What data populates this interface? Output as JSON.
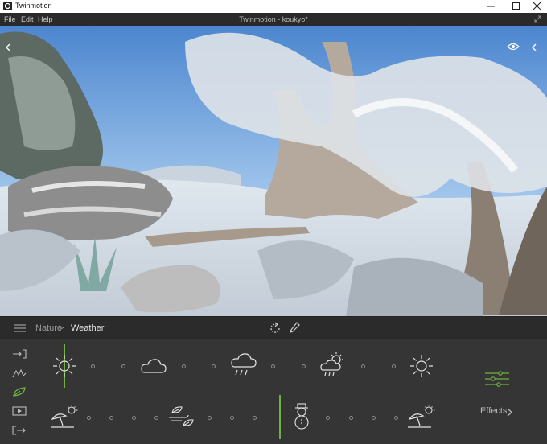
{
  "window": {
    "app_title": "Twinmotion",
    "icons": {
      "app": "twinmotion-logo-icon",
      "minimize": "minimize-icon",
      "maximize": "maximize-icon",
      "close": "close-icon"
    }
  },
  "menu": {
    "items": [
      "File",
      "Edit",
      "Help"
    ],
    "document_title": "Twinmotion - koukyo*",
    "expand_icon": "expand-icon"
  },
  "viewport": {
    "left_icon": "chevron-left-icon",
    "eye_icon": "eye-icon",
    "right_icon": "chevron-left-icon"
  },
  "breadcrumb": {
    "menu_icon": "hamburger-icon",
    "parent": "Nature",
    "separator": ">",
    "current": "Weather",
    "tools": [
      "refresh-icon",
      "pencil-icon"
    ]
  },
  "panel": {
    "side_icons": [
      "import-icon",
      "landscape-icon",
      "leaf-icon",
      "media-icon",
      "export-icon"
    ],
    "active_side_icon": "leaf-icon",
    "weather_row": [
      "sun-icon",
      "cloud-icon",
      "rain-icon",
      "partly-cloudy-rain-icon",
      "sun-icon"
    ],
    "season_row": [
      "beach-umbrella-sun-icon",
      "autumn-wind-leaf-icon",
      "snowman-icon",
      "beach-umbrella-sun-icon"
    ],
    "settings_icon": "sliders-icon",
    "effects_label": "Effects",
    "effects_icon": "chevron-right-icon",
    "accent_color": "#6db33f"
  }
}
